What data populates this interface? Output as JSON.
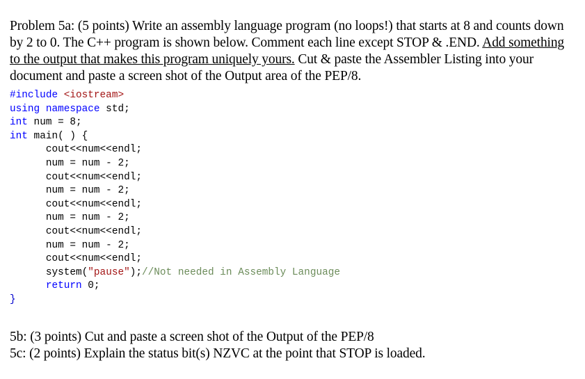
{
  "document": {
    "intro": {
      "before_underline": "Problem 5a: (5 points) Write an assembly language program (no loops!)  that starts at 8 and counts down by 2 to 0. The C++ program is shown below. Comment each line except STOP & .END. ",
      "underlined": "Add something to the output that makes this program uniquely yours.",
      "after_underline": " Cut & paste the Assembler Listing into your document and paste a screen shot of the Output area of the PEP/8."
    },
    "code": {
      "language": "C++",
      "lines": [
        {
          "indent": 0,
          "tokens": [
            {
              "text": "#include",
              "type": "keyword"
            },
            {
              "text": " ",
              "type": "plain"
            },
            {
              "text": "<iostream>",
              "type": "string"
            }
          ]
        },
        {
          "indent": 0,
          "tokens": [
            {
              "text": "using namespace",
              "type": "keyword"
            },
            {
              "text": " std;",
              "type": "plain"
            }
          ]
        },
        {
          "indent": 0,
          "tokens": [
            {
              "text": "int",
              "type": "keyword"
            },
            {
              "text": " num = 8;",
              "type": "plain"
            }
          ]
        },
        {
          "indent": 0,
          "tokens": [
            {
              "text": "int",
              "type": "keyword"
            },
            {
              "text": " main( ) {",
              "type": "plain"
            }
          ]
        },
        {
          "indent": 1,
          "tokens": [
            {
              "text": "cout<<num<<endl;",
              "type": "plain"
            }
          ]
        },
        {
          "indent": 1,
          "tokens": [
            {
              "text": "num = num - 2;",
              "type": "plain"
            }
          ]
        },
        {
          "indent": 1,
          "tokens": [
            {
              "text": "cout<<num<<endl;",
              "type": "plain"
            }
          ]
        },
        {
          "indent": 1,
          "tokens": [
            {
              "text": "num = num - 2;",
              "type": "plain"
            }
          ]
        },
        {
          "indent": 1,
          "tokens": [
            {
              "text": "cout<<num<<endl;",
              "type": "plain"
            }
          ]
        },
        {
          "indent": 1,
          "tokens": [
            {
              "text": "num = num - 2;",
              "type": "plain"
            }
          ]
        },
        {
          "indent": 1,
          "tokens": [
            {
              "text": "cout<<num<<endl;",
              "type": "plain"
            }
          ]
        },
        {
          "indent": 1,
          "tokens": [
            {
              "text": "num = num - 2;",
              "type": "plain"
            }
          ]
        },
        {
          "indent": 1,
          "tokens": [
            {
              "text": "cout<<num<<endl;",
              "type": "plain"
            }
          ]
        },
        {
          "indent": 1,
          "tokens": [
            {
              "text": "system(",
              "type": "plain"
            },
            {
              "text": "\"pause\"",
              "type": "string"
            },
            {
              "text": ");",
              "type": "plain"
            },
            {
              "text": "//Not needed in Assembly Language",
              "type": "comment"
            }
          ]
        },
        {
          "indent": 1,
          "tokens": [
            {
              "text": "return",
              "type": "keyword"
            },
            {
              "text": " 0;",
              "type": "plain"
            }
          ]
        },
        {
          "indent": 0,
          "tokens": [
            {
              "text": "}",
              "type": "brace"
            }
          ]
        }
      ]
    },
    "tail": {
      "line_5b": "5b: (3 points) Cut and paste a screen shot of the Output of the PEP/8",
      "line_5c": "5c: (2 points) Explain the status bit(s) NZVC at the point that STOP is loaded."
    }
  },
  "colors": {
    "background": "#ffffff",
    "text": "#000000",
    "keyword": "#0000ff",
    "string": "#a31515",
    "comment": "#6c8c5a",
    "brace": "#0000cd"
  }
}
